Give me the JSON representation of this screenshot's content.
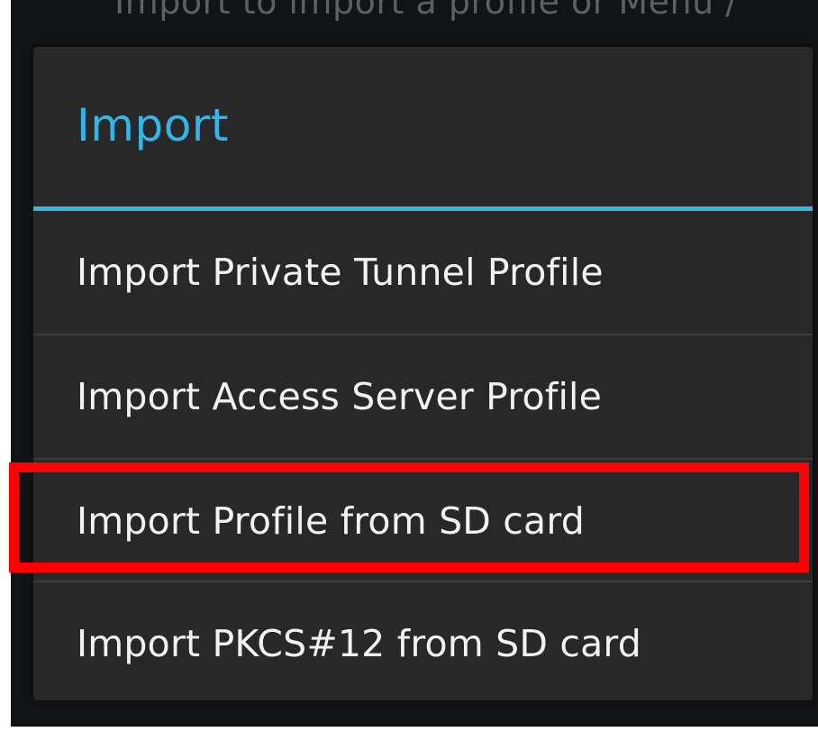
{
  "background": {
    "partial_text": "Import to import a profile or Menu /"
  },
  "dialog": {
    "title": "Import",
    "items": [
      {
        "label": "Import Private Tunnel Profile"
      },
      {
        "label": "Import Access Server Profile"
      },
      {
        "label": "Import Profile from SD card"
      },
      {
        "label": "Import PKCS#12 from SD card"
      }
    ]
  },
  "colors": {
    "accent": "#33b5e5",
    "dialog_bg": "#282828",
    "screen_bg": "#111315",
    "highlight": "#ff0000"
  }
}
